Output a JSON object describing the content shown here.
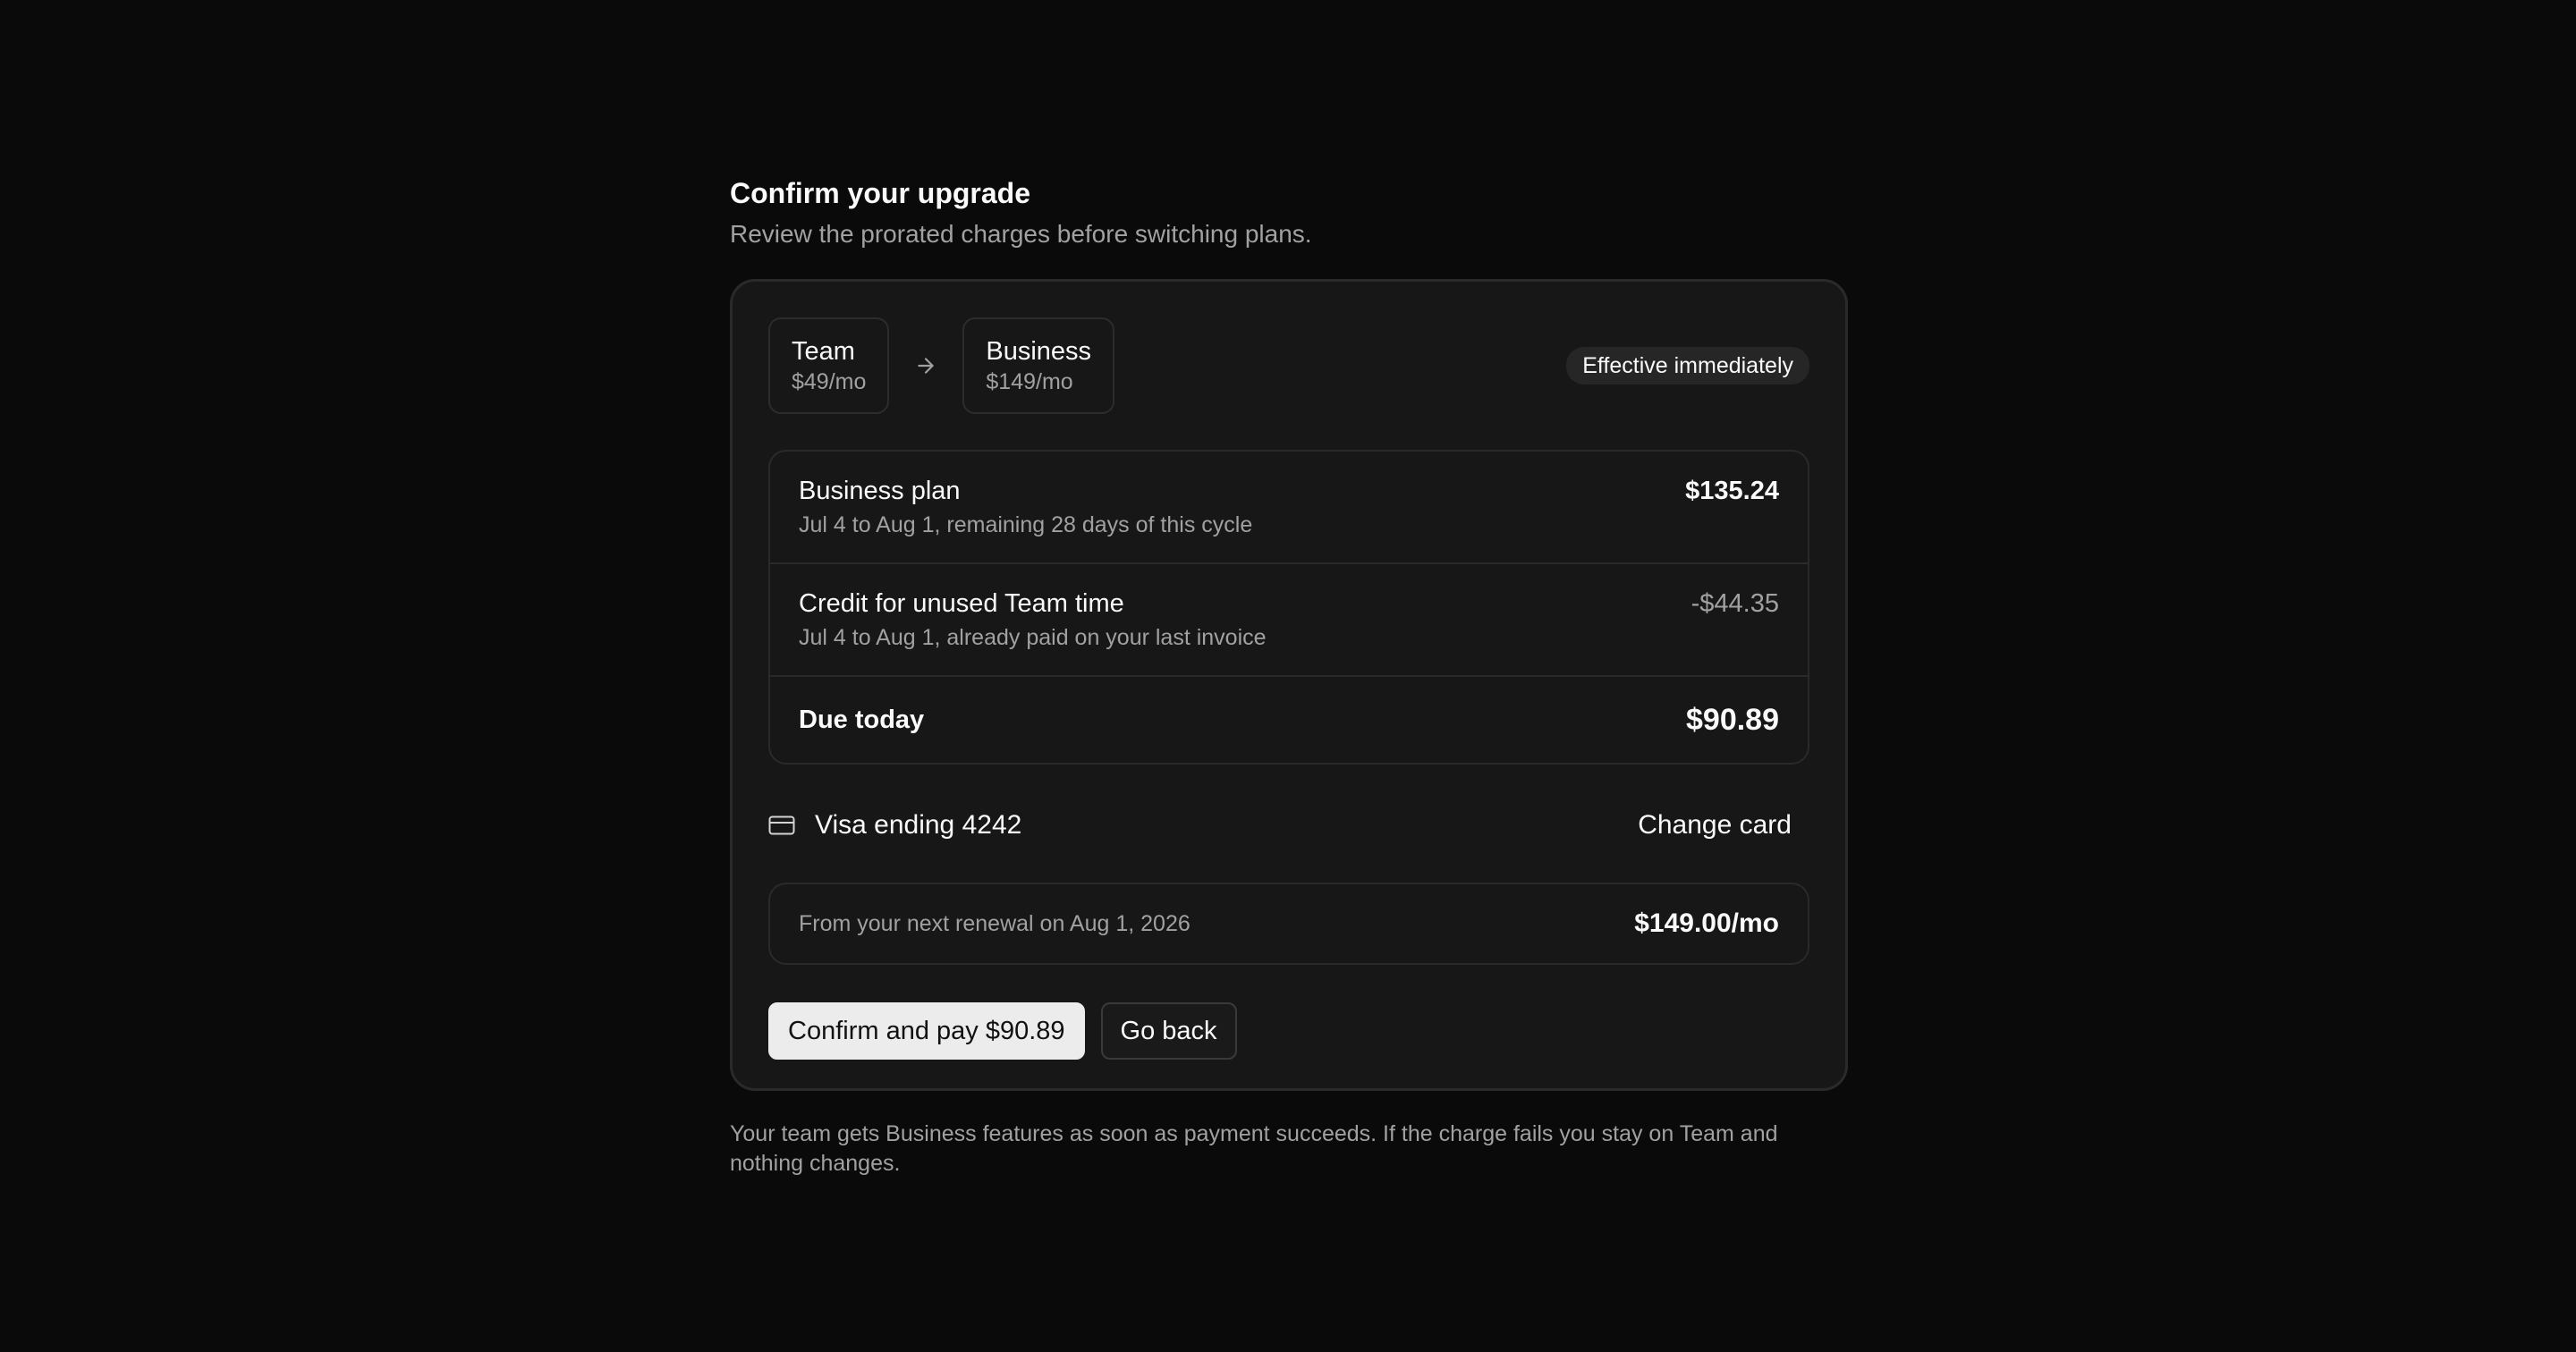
{
  "header": {
    "title": "Confirm your upgrade",
    "subtitle": "Review the prorated charges before switching plans."
  },
  "plan_change": {
    "from": {
      "name": "Team",
      "price": "$49/mo"
    },
    "to": {
      "name": "Business",
      "price": "$149/mo"
    },
    "arrow_icon": "arrow-right-icon",
    "badge": "Effective immediately"
  },
  "line_items": [
    {
      "title": "Business plan",
      "detail": "Jul 4 to Aug 1, remaining 28 days of this cycle",
      "amount": "$135.24"
    },
    {
      "title": "Credit for unused Team time",
      "detail": "Jul 4 to Aug 1, already paid on your last invoice",
      "amount": "-$44.35"
    }
  ],
  "total": {
    "label": "Due today",
    "amount": "$90.89"
  },
  "payment": {
    "icon": "credit-card-icon",
    "label": "Visa ending 4242",
    "change_label": "Change card"
  },
  "renewal": {
    "text": "From your next renewal on Aug 1, 2026",
    "amount": "$149.00/mo"
  },
  "actions": {
    "confirm_label": "Confirm and pay $90.89",
    "back_label": "Go back"
  },
  "footnote": "Your team gets Business features as soon as payment succeeds. If the charge fails you stay on Team and nothing changes.",
  "colors": {
    "background": "#0a0a0a",
    "card": "#171717",
    "border": "#2a2a2a",
    "text": "#fafafa",
    "muted": "#a1a1a1",
    "primary_button": "#ececec"
  }
}
